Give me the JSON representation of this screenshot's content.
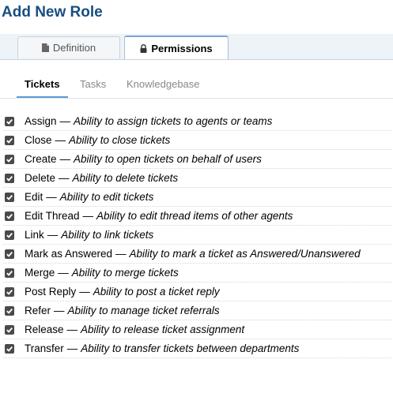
{
  "page": {
    "title": "Add New Role"
  },
  "tabs": [
    {
      "label": "Definition",
      "icon": "document-icon",
      "active": false
    },
    {
      "label": "Permissions",
      "icon": "lock-icon",
      "active": true
    }
  ],
  "subtabs": [
    {
      "label": "Tickets",
      "active": true
    },
    {
      "label": "Tasks",
      "active": false
    },
    {
      "label": "Knowledgebase",
      "active": false
    }
  ],
  "separator": "—",
  "permissions": [
    {
      "name": "Assign",
      "description": "Ability to assign tickets to agents or teams",
      "checked": true
    },
    {
      "name": "Close",
      "description": "Ability to close tickets",
      "checked": true
    },
    {
      "name": "Create",
      "description": "Ability to open tickets on behalf of users",
      "checked": true
    },
    {
      "name": "Delete",
      "description": "Ability to delete tickets",
      "checked": true
    },
    {
      "name": "Edit",
      "description": "Ability to edit tickets",
      "checked": true
    },
    {
      "name": "Edit Thread",
      "description": "Ability to edit thread items of other agents",
      "checked": true
    },
    {
      "name": "Link",
      "description": "Ability to link tickets",
      "checked": true
    },
    {
      "name": "Mark as Answered",
      "description": "Ability to mark a ticket as Answered/Unanswered",
      "checked": true
    },
    {
      "name": "Merge",
      "description": "Ability to merge tickets",
      "checked": true
    },
    {
      "name": "Post Reply",
      "description": "Ability to post a ticket reply",
      "checked": true
    },
    {
      "name": "Refer",
      "description": "Ability to manage ticket referrals",
      "checked": true
    },
    {
      "name": "Release",
      "description": "Ability to release ticket assignment",
      "checked": true
    },
    {
      "name": "Transfer",
      "description": "Ability to transfer tickets between departments",
      "checked": true
    }
  ]
}
